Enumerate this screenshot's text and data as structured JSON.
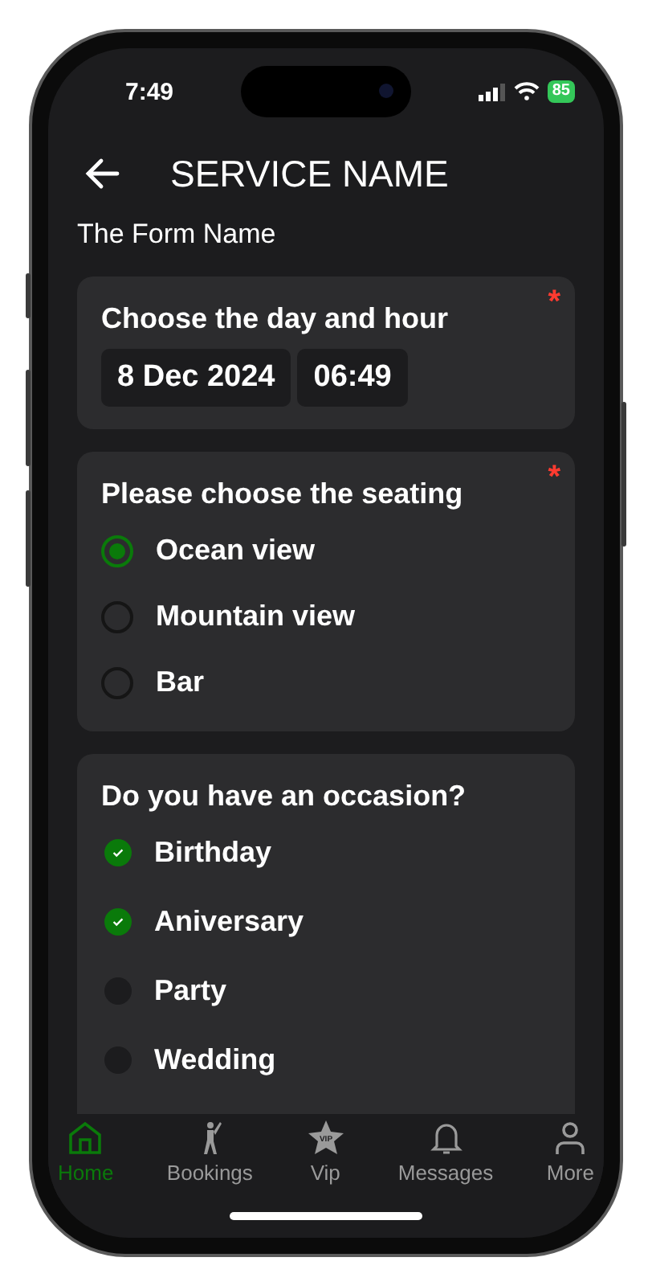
{
  "status_bar": {
    "time": "7:49",
    "battery": "85"
  },
  "header": {
    "title": "SERVICE NAME"
  },
  "form_name": "The Form Name",
  "sections": [
    {
      "kind": "datetime",
      "title": "Choose the day and hour",
      "required": true,
      "date": "8 Dec 2024",
      "time": "06:49"
    },
    {
      "kind": "radio",
      "title": "Please choose the seating",
      "required": true,
      "options": [
        {
          "label": "Ocean view",
          "selected": true
        },
        {
          "label": "Mountain view",
          "selected": false
        },
        {
          "label": "Bar",
          "selected": false
        }
      ]
    },
    {
      "kind": "checkbox",
      "title": "Do you have an occasion?",
      "required": false,
      "options": [
        {
          "label": "Birthday",
          "checked": true
        },
        {
          "label": "Aniversary",
          "checked": true
        },
        {
          "label": "Party",
          "checked": false
        },
        {
          "label": "Wedding",
          "checked": false
        }
      ]
    }
  ],
  "required_mark": "*",
  "tab_bar": [
    {
      "label": "Home",
      "kind": "home",
      "selected": true
    },
    {
      "label": "Bookings",
      "kind": "golfer",
      "selected": false
    },
    {
      "label": "Vip",
      "kind": "star",
      "badge": "VIP",
      "selected": false
    },
    {
      "label": "Messages",
      "kind": "bell",
      "selected": false
    },
    {
      "label": "More",
      "kind": "person",
      "selected": false
    }
  ]
}
